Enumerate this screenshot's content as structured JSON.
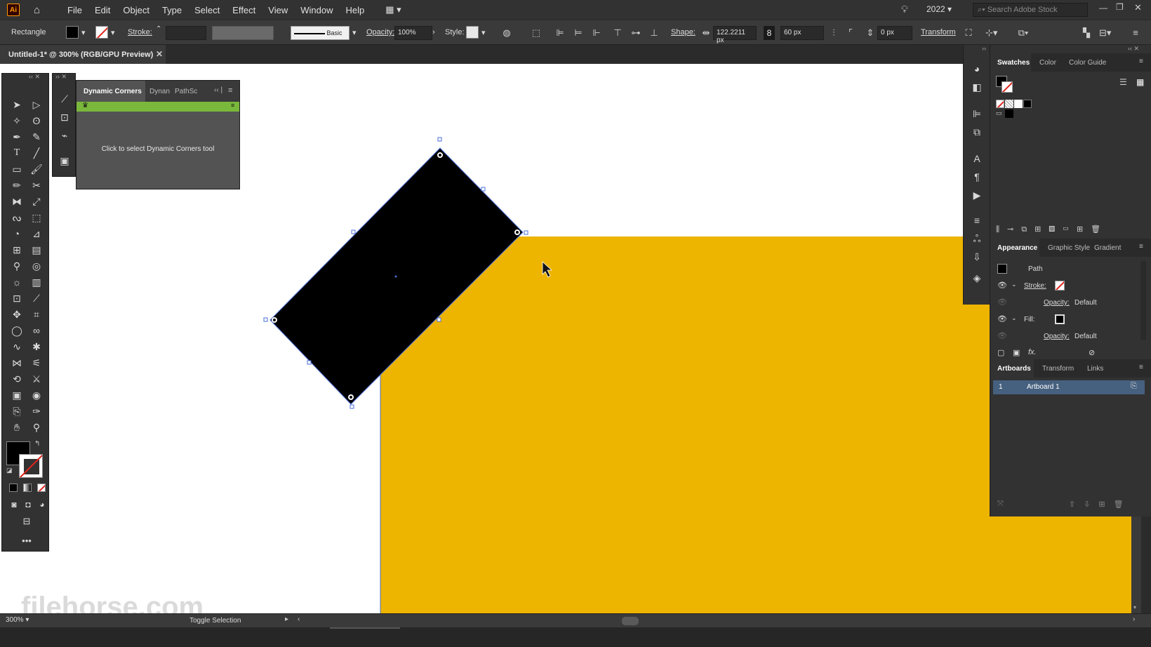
{
  "app": {
    "logo_text": "Ai",
    "version": "2022"
  },
  "menu": [
    "File",
    "Edit",
    "Object",
    "Type",
    "Select",
    "Effect",
    "View",
    "Window",
    "Help"
  ],
  "search": {
    "placeholder": "Search Adobe Stock"
  },
  "control": {
    "object_type": "Rectangle",
    "stroke_label": "Stroke:",
    "brush_label": "Basic",
    "opacity_label": "Opacity:",
    "opacity_value": "100%",
    "style_label": "Style:",
    "shape_label": "Shape:",
    "width_value": "122.2211 px",
    "height_value": "60 px",
    "corner_value": "0 px",
    "transform_label": "Transform"
  },
  "document": {
    "tab_title": "Untitled-1* @ 300% (RGB/GPU Preview)",
    "zoom": "300%"
  },
  "dynamic_corners": {
    "tab_active": "Dynamic Corners",
    "tab2": "Dynan",
    "tab3": "PathSc",
    "message": "Click to select Dynamic Corners tool"
  },
  "swatches_panel": {
    "tabs": [
      "Swatches",
      "Color",
      "Color Guide"
    ]
  },
  "appearance_panel": {
    "tabs": [
      "Appearance",
      "Graphic Style",
      "Gradient"
    ],
    "path_label": "Path",
    "stroke_label": "Stroke:",
    "fill_label": "Fill:",
    "opacity_label": "Opacity:",
    "opacity_value": "Default",
    "fx_label": "fx."
  },
  "artboards_panel": {
    "tabs": [
      "Artboards",
      "Transform",
      "Links"
    ],
    "items": [
      {
        "index": "1",
        "name": "Artboard 1"
      }
    ]
  },
  "status": {
    "hint": "Toggle Selection"
  },
  "watermark": "filehorse.com",
  "colors": {
    "artboard_fill": "#edb400",
    "shape_fill": "#000000",
    "fill_swatch": "#000000",
    "selection": "#4a6fd8"
  }
}
